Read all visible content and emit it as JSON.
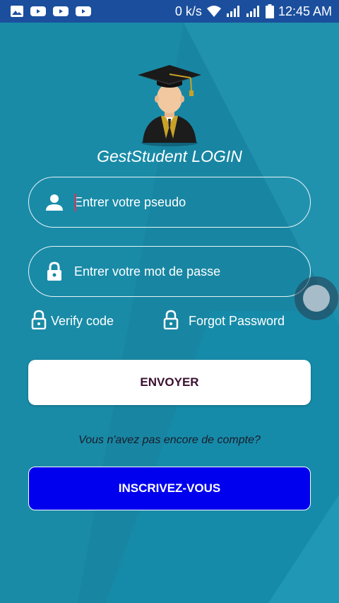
{
  "status_bar": {
    "network_speed": "0 k/s",
    "time": "12:45 AM",
    "notification_icons": [
      "gallery-icon",
      "youtube-icon",
      "youtube-icon",
      "youtube-icon"
    ],
    "indicator_icons": [
      "wifi-icon",
      "signal-icon",
      "signal-icon",
      "battery-icon"
    ]
  },
  "login": {
    "title": "GestStudent LOGIN",
    "username": {
      "placeholder": "Entrer votre pseudo",
      "value": "",
      "icon": "person-icon"
    },
    "password": {
      "placeholder": "Entrer votre mot de passe",
      "value": "",
      "icon": "lock-icon"
    },
    "verify_code_label": "Verify code",
    "forgot_password_label": "Forgot Password",
    "submit_label": "ENVOYER",
    "no_account_prompt": "Vous n'avez pas encore de compte?",
    "register_label": "INSCRIVEZ-VOUS"
  },
  "colors": {
    "background": "#1a86a3",
    "status_bar": "#1b4f9d",
    "register_button": "#0000ee",
    "submit_button": "#ffffff"
  }
}
